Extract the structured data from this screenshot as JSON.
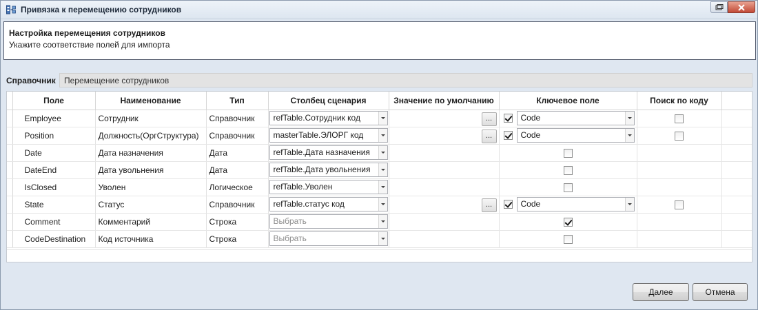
{
  "window": {
    "title": "Привязка к перемещению сотрудников"
  },
  "header": {
    "title": "Настройка перемещения сотрудников",
    "subtitle": "Укажите соответствие полей для импорта"
  },
  "reference": {
    "label": "Справочник",
    "value": "Перемещение сотрудников"
  },
  "table": {
    "columns": [
      "Поле",
      "Наименование",
      "Тип",
      "Столбец сценария",
      "Значение по умолчанию",
      "Ключевое поле",
      "Поиск по коду"
    ],
    "rows": [
      {
        "field": "Employee",
        "name": "Сотрудник",
        "type": "Справочник",
        "column": "refTable.Сотрудник код",
        "column_placeholder": false,
        "has_default_button": true,
        "key_checked": true,
        "key_value": "Code",
        "has_search": true,
        "search_checked": false
      },
      {
        "field": "Position",
        "name": "Должность(ОргСтруктура)",
        "type": "Справочник",
        "column": "masterTable.ЭЛОРГ код",
        "column_placeholder": false,
        "has_default_button": true,
        "key_checked": true,
        "key_value": "Code",
        "has_search": true,
        "search_checked": false
      },
      {
        "field": "Date",
        "name": "Дата назначения",
        "type": "Дата",
        "column": "refTable.Дата назначения",
        "column_placeholder": false,
        "has_default_button": false,
        "key_checked": false,
        "key_value": "",
        "has_search": false,
        "search_checked": false
      },
      {
        "field": "DateEnd",
        "name": "Дата увольнения",
        "type": "Дата",
        "column": "refTable.Дата увольнения",
        "column_placeholder": false,
        "has_default_button": false,
        "key_checked": false,
        "key_value": "",
        "has_search": false,
        "search_checked": false
      },
      {
        "field": "IsClosed",
        "name": "Уволен",
        "type": "Логическое",
        "column": "refTable.Уволен",
        "column_placeholder": false,
        "has_default_button": false,
        "key_checked": false,
        "key_value": "",
        "has_search": false,
        "search_checked": false
      },
      {
        "field": "State",
        "name": "Статус",
        "type": "Справочник",
        "column": "refTable.статус код",
        "column_placeholder": false,
        "has_default_button": true,
        "key_checked": true,
        "key_value": "Code",
        "has_search": true,
        "search_checked": false
      },
      {
        "field": "Comment",
        "name": "Комментарий",
        "type": "Строка",
        "column": "Выбрать",
        "column_placeholder": true,
        "has_default_button": false,
        "key_checked": true,
        "key_value": "",
        "has_search": false,
        "search_checked": false
      },
      {
        "field": "CodeDestination",
        "name": "Код источника",
        "type": "Строка",
        "column": "Выбрать",
        "column_placeholder": true,
        "has_default_button": false,
        "key_checked": false,
        "key_value": "",
        "has_search": false,
        "search_checked": false
      }
    ],
    "ellipsis_label": "..."
  },
  "buttons": {
    "next": "Далее",
    "cancel": "Отмена"
  }
}
